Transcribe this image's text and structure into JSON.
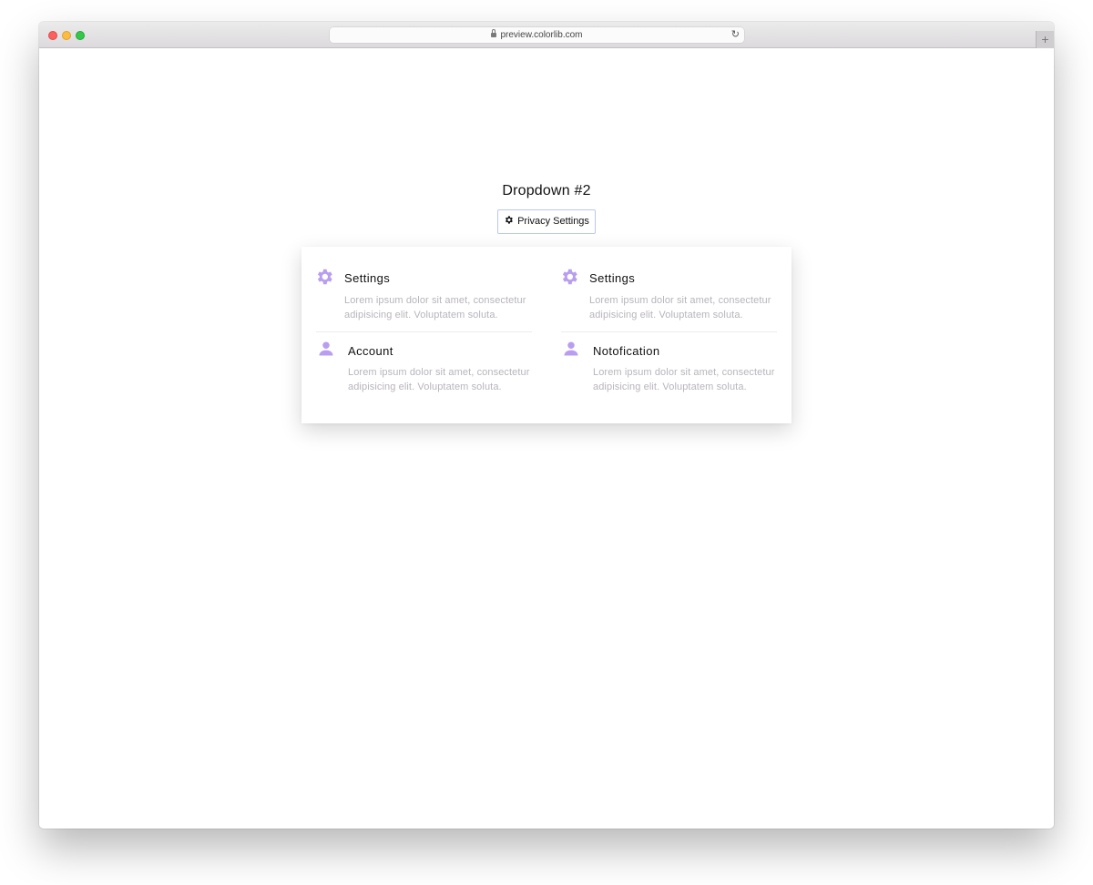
{
  "browser": {
    "url": "preview.colorlib.com",
    "new_tab_symbol": "+"
  },
  "page": {
    "title": "Dropdown #2"
  },
  "dropdown": {
    "button_label": "Privacy Settings",
    "button_icon": "gear-icon",
    "items": [
      {
        "icon": "gear-icon",
        "title": "Settings",
        "description": "Lorem ipsum dolor sit amet, consectetur adipisicing elit. Voluptatem soluta."
      },
      {
        "icon": "gear-icon",
        "title": "Settings",
        "description": "Lorem ipsum dolor sit amet, consectetur adipisicing elit. Voluptatem soluta."
      },
      {
        "icon": "user-icon",
        "title": "Account",
        "description": "Lorem ipsum dolor sit amet, consectetur adipisicing elit. Voluptatem soluta."
      },
      {
        "icon": "user-icon",
        "title": "Notofication",
        "description": "Lorem ipsum dolor sit amet, consectetur adipisicing elit. Voluptatem soluta."
      }
    ]
  },
  "colors": {
    "accent_icon": "#b89ef0",
    "button_border": "#b9c8ee",
    "description_text": "#b8b4bc"
  }
}
